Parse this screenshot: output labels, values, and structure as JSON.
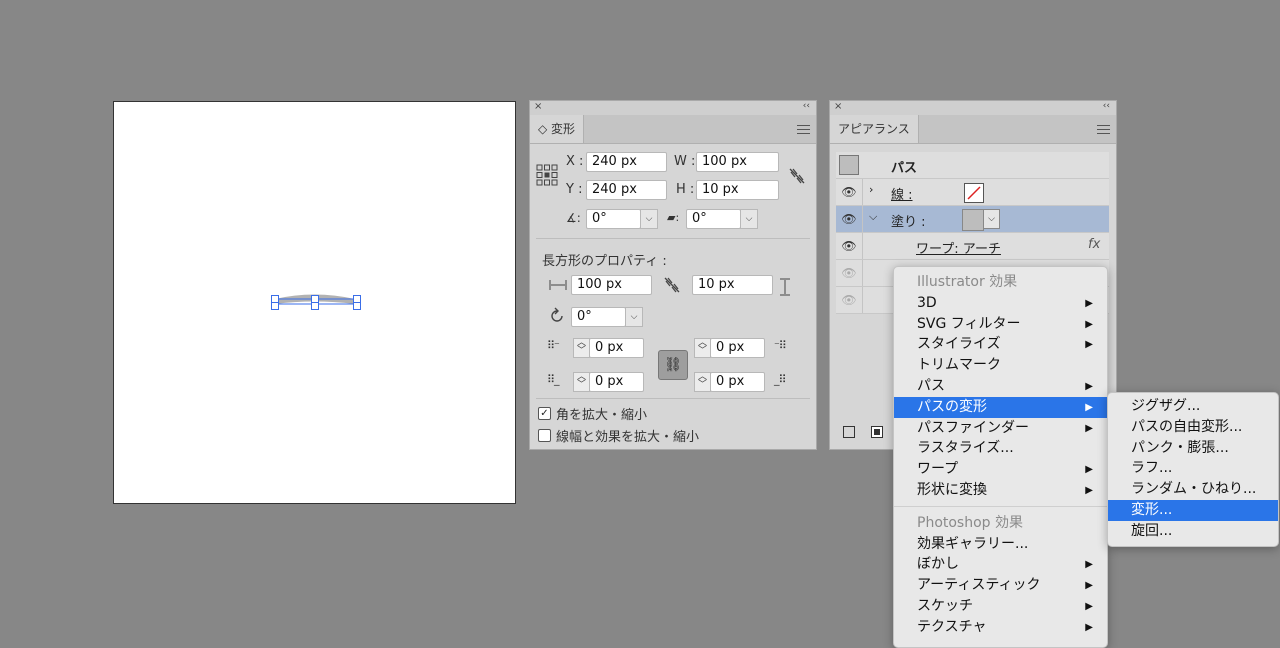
{
  "transform_panel": {
    "close": "×",
    "collapse": "‹‹",
    "tab": "◇ 変形",
    "x_label": "X :",
    "x_value": "240 px",
    "y_label": "Y :",
    "y_value": "240 px",
    "w_label": "W :",
    "w_value": "100 px",
    "h_label": "H :",
    "h_value": "10 px",
    "angle_icon": "∡:",
    "angle_value": "0°",
    "shear_icon": "▰:",
    "shear_value": "0°",
    "rect_props_label": "長方形のプロパティ :",
    "rect_w_value": "100 px",
    "rect_h_value": "10 px",
    "rect_angle_value": "0°",
    "corner_tl": "0 px",
    "corner_tr": "0 px",
    "corner_bl": "0 px",
    "corner_br": "0 px",
    "scale_corners_label": "角を拡大・縮小",
    "scale_corners_checked": true,
    "scale_strokes_label": "線幅と効果を拡大・縮小",
    "scale_strokes_checked": false
  },
  "appearance_panel": {
    "close": "×",
    "collapse": "‹‹",
    "tab": "アピアランス",
    "path_title": "パス",
    "stroke_label": "線 :",
    "fill_label": "塗り :",
    "warp_label": "ワープ: アーチ",
    "fx": "fx"
  },
  "effect_menu": {
    "items": [
      {
        "label": "Illustrator 効果",
        "header": true
      },
      {
        "label": "3D",
        "arrow": true
      },
      {
        "label": "SVG フィルター",
        "arrow": true
      },
      {
        "label": "スタイライズ",
        "arrow": true
      },
      {
        "label": "トリムマーク",
        "arrow": false
      },
      {
        "label": "パス",
        "arrow": true
      },
      {
        "label": "パスの変形",
        "arrow": true,
        "highlighted": true
      },
      {
        "label": "パスファインダー",
        "arrow": true
      },
      {
        "label": "ラスタライズ...",
        "arrow": false
      },
      {
        "label": "ワープ",
        "arrow": true
      },
      {
        "label": "形状に変換",
        "arrow": true
      },
      {
        "label": "Photoshop 効果",
        "header": true
      },
      {
        "label": "効果ギャラリー...",
        "arrow": false
      },
      {
        "label": "ぼかし",
        "arrow": true
      },
      {
        "label": "アーティスティック",
        "arrow": true
      },
      {
        "label": "スケッチ",
        "arrow": true
      },
      {
        "label": "テクスチャ",
        "arrow": true
      }
    ]
  },
  "submenu": {
    "items": [
      {
        "label": "ジグザグ..."
      },
      {
        "label": "パスの自由変形..."
      },
      {
        "label": "パンク・膨張..."
      },
      {
        "label": "ラフ..."
      },
      {
        "label": "ランダム・ひねり..."
      },
      {
        "label": "変形...",
        "highlighted": true
      },
      {
        "label": "旋回..."
      }
    ]
  },
  "arrow_glyph": "▶",
  "colors": {
    "accent": "#2a75e8",
    "selection": "#3a6ee8"
  }
}
